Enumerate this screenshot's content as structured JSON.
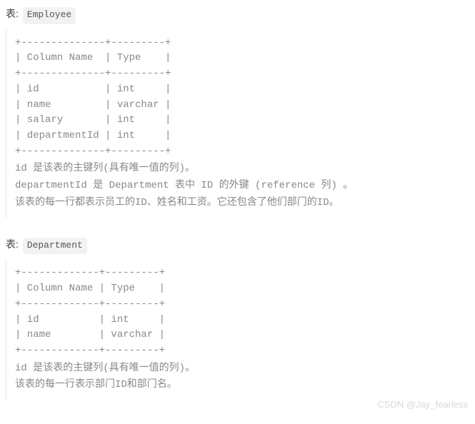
{
  "table1": {
    "label_prefix": "表: ",
    "name": "Employee",
    "schema": "+--------------+---------+\n| Column Name  | Type    |\n+--------------+---------+\n| id           | int     |\n| name         | varchar |\n| salary       | int     |\n| departmentId | int     |\n+--------------+---------+",
    "desc_line1": "id 是该表的主键列(具有唯一值的列)。",
    "desc_line2": "departmentId 是 Department 表中 ID 的外键 (reference 列) 。",
    "desc_line3": "该表的每一行都表示员工的ID、姓名和工资。它还包含了他们部门的ID。"
  },
  "table2": {
    "label_prefix": "表: ",
    "name": "Department",
    "schema": "+-------------+---------+\n| Column Name | Type    |\n+-------------+---------+\n| id          | int     |\n| name        | varchar |\n+-------------+---------+",
    "desc_line1": "id 是该表的主键列(具有唯一值的列)。",
    "desc_line2": "该表的每一行表示部门ID和部门名。"
  },
  "watermark": "CSDN @Jay_fearless"
}
